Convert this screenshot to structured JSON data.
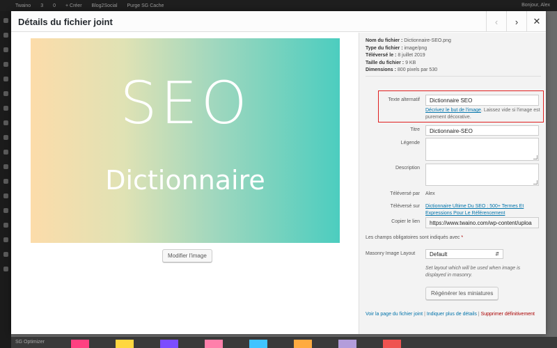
{
  "adminbar": {
    "items": [
      "Twaino",
      "3",
      "0",
      "+ Créer",
      "Blog2Social",
      "Purge SG Cache"
    ],
    "right": "Bonjour, Alex"
  },
  "bottombar": {
    "left": "SG Optimizer",
    "thumb_colors": [
      "#ff4081",
      "#ffd740",
      "#7c4dff",
      "#ff80ab",
      "#40c4ff",
      "#ffab40",
      "#b39ddb",
      "#ef5350"
    ]
  },
  "header": {
    "title": "Détails du fichier joint"
  },
  "preview": {
    "big": "SEO",
    "small": "Dictionnaire",
    "gradient_start": "#fcdcaa",
    "gradient_end": "#4ccdbf"
  },
  "edit_button": "Modifier l'image",
  "meta": [
    {
      "k": "Nom du fichier :",
      "v": "Dictionnaire-SEO.png"
    },
    {
      "k": "Type du fichier :",
      "v": "image/png"
    },
    {
      "k": "Téléversé le :",
      "v": "8 juillet 2019"
    },
    {
      "k": "Taille du fichier :",
      "v": "9 KB"
    },
    {
      "k": "Dimensions :",
      "v": "800 pixels par 530"
    }
  ],
  "alt": {
    "label": "Texte alternatif",
    "value": "Dictionnaire SEO",
    "help_link": "Décrivez le but de l'image",
    "help_rest": ". Laissez vide si l'image est purement décorative."
  },
  "title_field": {
    "label": "Titre",
    "value": "Dictionnaire-SEO"
  },
  "caption": {
    "label": "Légende"
  },
  "description": {
    "label": "Description"
  },
  "uploaded_by": {
    "label": "Téléversé par",
    "value": "Alex"
  },
  "uploaded_to": {
    "label": "Téléversé sur",
    "value": "Dictionnaire Ultime Du SEO : 500+ Termes Et Expressions Pour Le Référencement"
  },
  "copy_link": {
    "label": "Copier le lien",
    "value": "https://www.twaino.com/wp-content/uploa"
  },
  "required_note": "Les champs obligatoires sont indiqués avec",
  "required_star": "*",
  "masonry": {
    "label": "Masonry Image Layout",
    "value": "Default",
    "help": "Set layout which will be used when image is displayed in masonry."
  },
  "regen_button": "Régénérer les miniatures",
  "footer": {
    "view": "Voir la page du fichier joint",
    "sep1": "|",
    "more": "Indiquer plus de détails",
    "sep2": "|",
    "delete": "Supprimer définitivement"
  }
}
